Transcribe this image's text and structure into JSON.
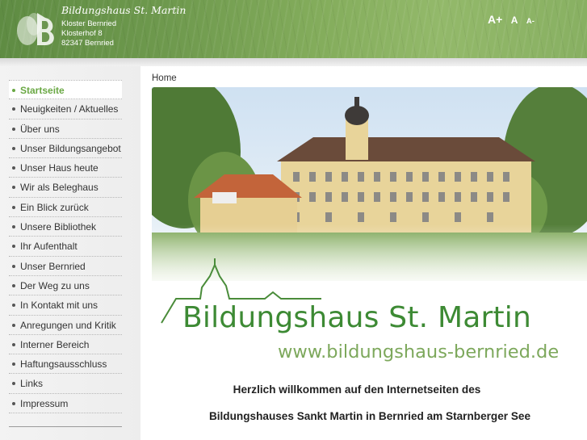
{
  "header": {
    "brand": "Bildungshaus St. Martin",
    "address": [
      "Kloster Bernried",
      "Klosterhof 8",
      "82347 Bernried"
    ],
    "font_size_controls": [
      "A+",
      "A",
      "A-"
    ]
  },
  "nav": {
    "items": [
      {
        "label": "Startseite",
        "active": true
      },
      {
        "label": "Neuigkeiten / Aktuelles"
      },
      {
        "label": "Über uns"
      },
      {
        "label": "Unser Bildungsangebot"
      },
      {
        "label": "Unser Haus heute"
      },
      {
        "label": "Wir als Beleghaus"
      },
      {
        "label": "Ein Blick zurück"
      },
      {
        "label": "Unsere Bibliothek"
      },
      {
        "label": "Ihr Aufenthalt"
      },
      {
        "label": "Unser Bernried"
      },
      {
        "label": "Der Weg zu uns"
      },
      {
        "label": "In Kontakt mit uns"
      },
      {
        "label": "Anregungen und Kritik"
      },
      {
        "label": "Interner Bereich"
      },
      {
        "label": "Haftungsausschluss"
      },
      {
        "label": "Links"
      },
      {
        "label": "Impressum"
      }
    ]
  },
  "breadcrumb": "Home",
  "hero": {
    "title": "Bildungshaus St. Martin",
    "url": "www.bildungshaus-bernried.de"
  },
  "welcome": {
    "line1": "Herzlich willkommen auf den Internetseiten des",
    "line2": "Bildungshauses Sankt Martin in Bernried am Starnberger See"
  },
  "colors": {
    "header_green": "#6f9a4e",
    "accent_green": "#6aa844",
    "logo_green": "#4a8c3a"
  }
}
